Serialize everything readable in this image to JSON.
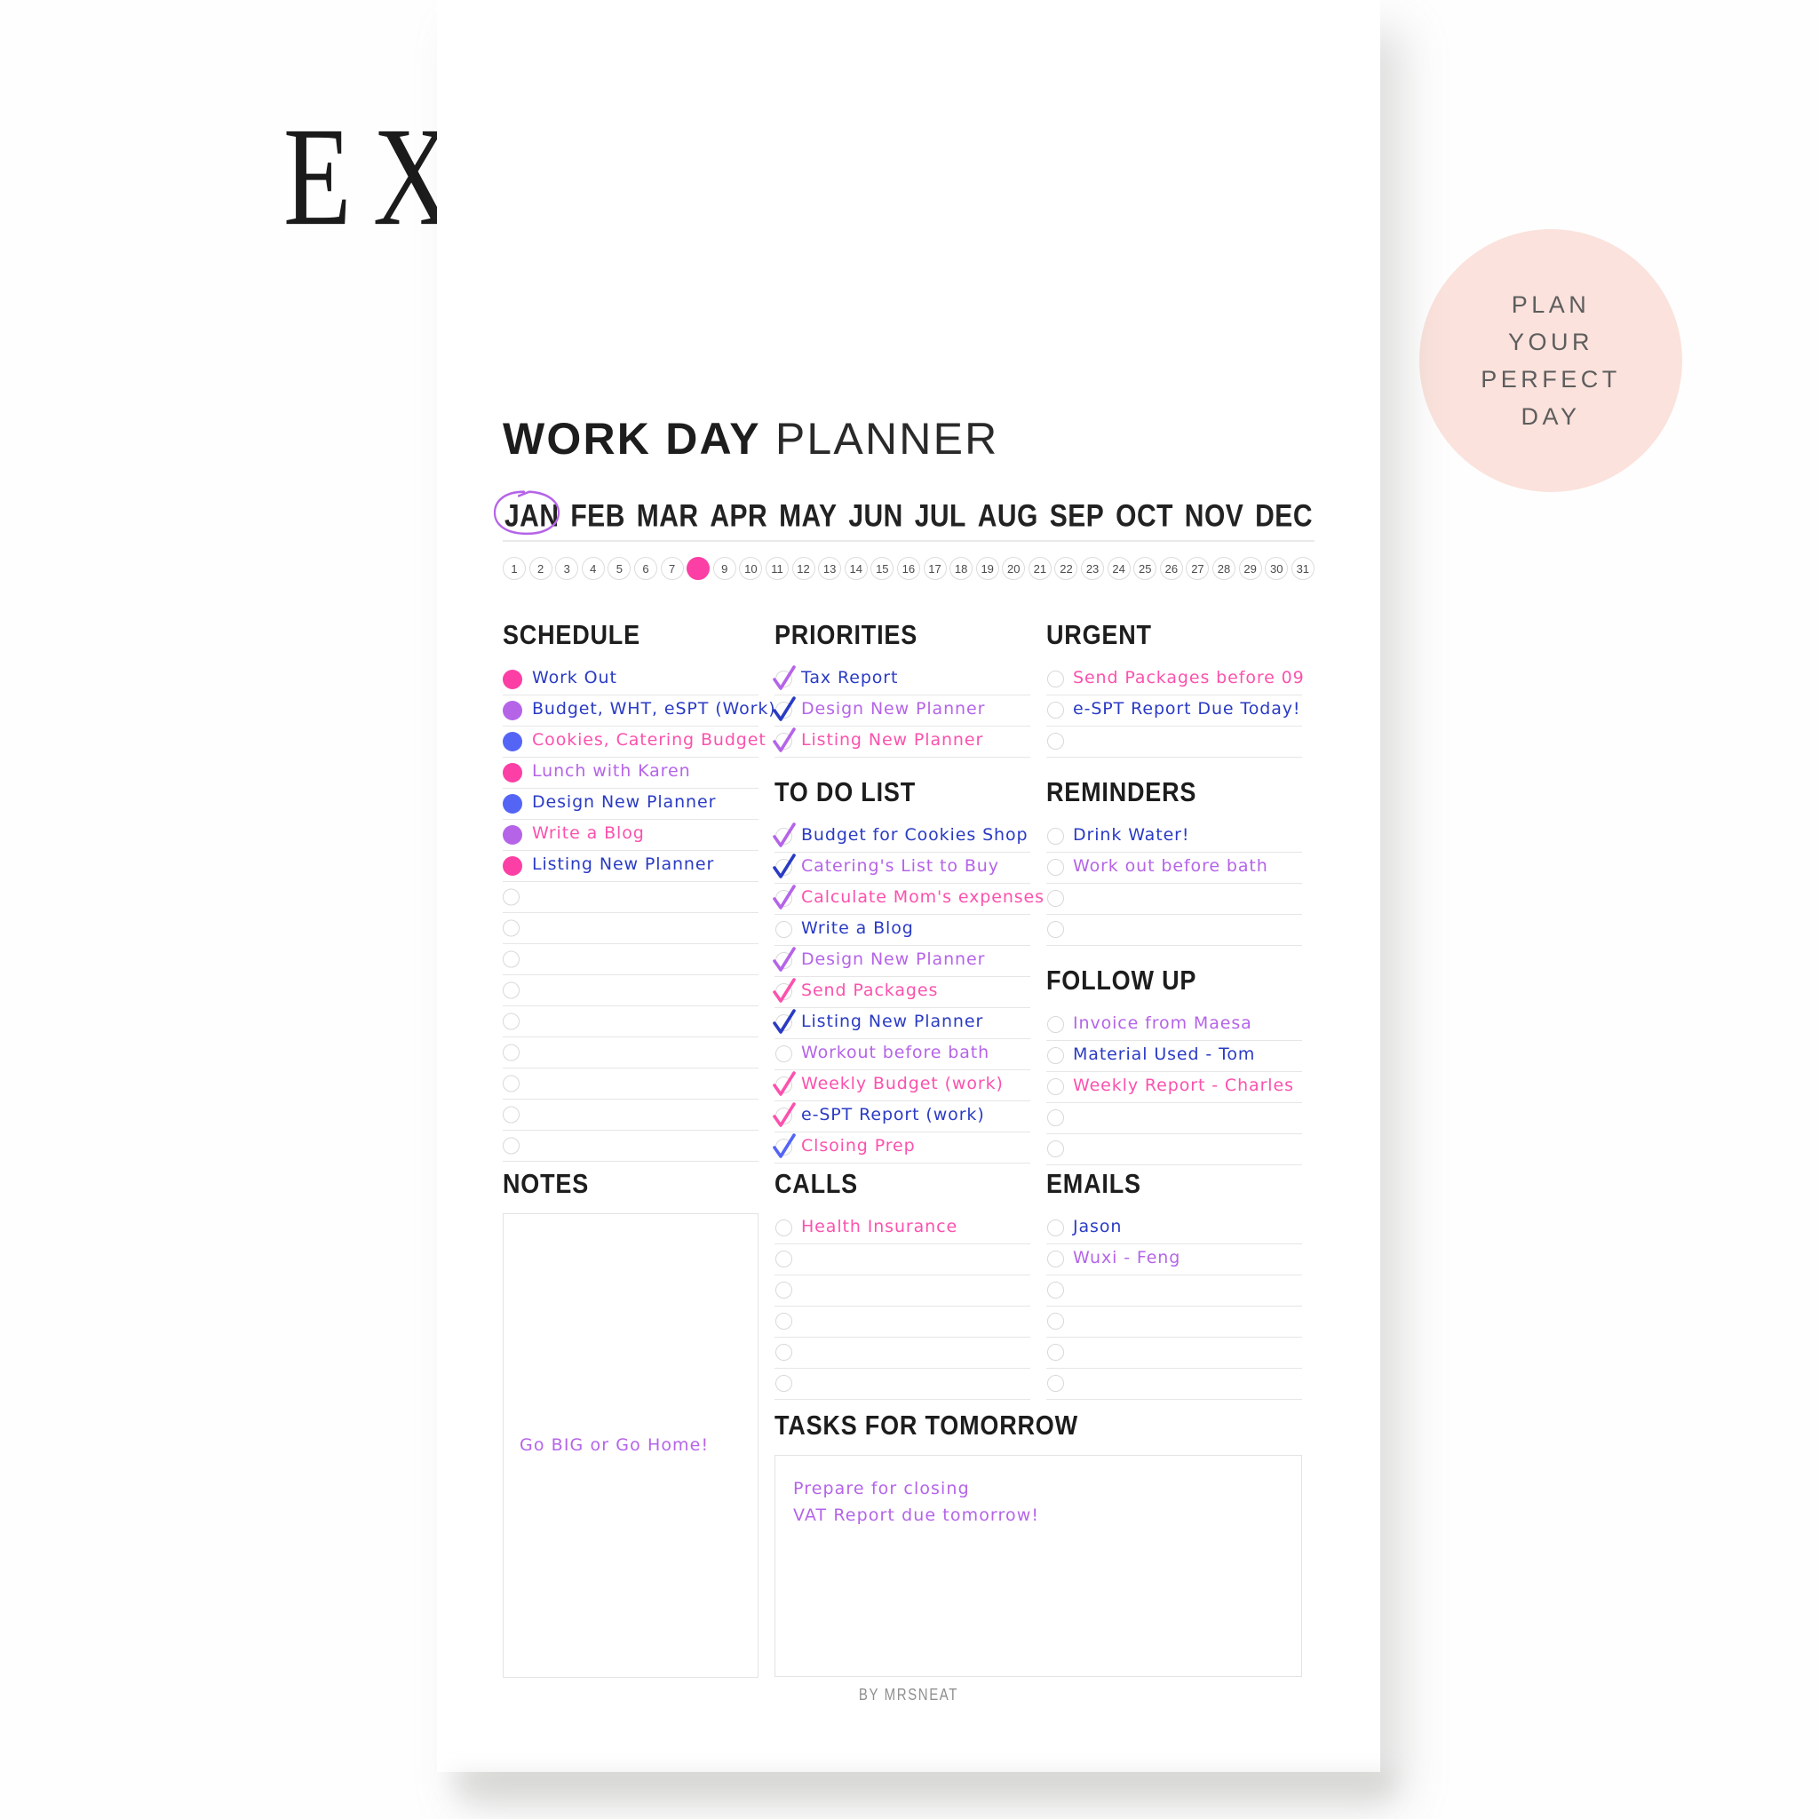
{
  "watermark": {
    "text": "EXAMPLE"
  },
  "badge": {
    "lines": [
      "PLAN",
      "YOUR",
      "PERFECT",
      "DAY"
    ],
    "bg_color": "#fbe2dc"
  },
  "page_title": {
    "bold": "WORK DAY",
    "light": "PLANNER"
  },
  "footer": {
    "text": "BY MRSNEAT"
  },
  "colors": {
    "pink": "#fb3fa5",
    "hot_pink": "#fb52ad",
    "purple": "#b564e8",
    "blue": "#2a3bc4",
    "bullet_blue": "#5465f6",
    "line": "#e6e6e6",
    "badge_pink": "#fbe2dc"
  },
  "calendar": {
    "months": [
      "JAN",
      "FEB",
      "MAR",
      "APR",
      "MAY",
      "JUN",
      "JUL",
      "AUG",
      "SEP",
      "OCT",
      "NOV",
      "DEC"
    ],
    "selected_month": "JAN",
    "days": [
      1,
      2,
      3,
      4,
      5,
      6,
      7,
      8,
      9,
      10,
      11,
      12,
      13,
      14,
      15,
      16,
      17,
      18,
      19,
      20,
      21,
      22,
      23,
      24,
      25,
      26,
      27,
      28,
      29,
      30,
      31
    ],
    "selected_day": 8
  },
  "sections": {
    "schedule": {
      "title": "SCHEDULE",
      "total_rows": 16,
      "items": [
        {
          "text": "Work Out",
          "bullet": "pink",
          "text_color": "blue"
        },
        {
          "text": "Budget, WHT, eSPT (Work)",
          "bullet": "purple",
          "text_color": "blue"
        },
        {
          "text": "Cookies, Catering Budget",
          "bullet": "bullet_blue",
          "text_color": "hot_pink"
        },
        {
          "text": "Lunch with Karen",
          "bullet": "pink",
          "text_color": "purple"
        },
        {
          "text": "Design New Planner",
          "bullet": "bullet_blue",
          "text_color": "blue"
        },
        {
          "text": "Write a Blog",
          "bullet": "purple",
          "text_color": "hot_pink"
        },
        {
          "text": "Listing New Planner",
          "bullet": "pink",
          "text_color": "blue"
        }
      ]
    },
    "priorities": {
      "title": "PRIORITIES",
      "total_rows": 3,
      "items": [
        {
          "text": "Tax Report",
          "checked": true,
          "check_color": "purple",
          "text_color": "blue"
        },
        {
          "text": "Design New Planner",
          "checked": true,
          "check_color": "blue",
          "text_color": "purple"
        },
        {
          "text": "Listing New Planner",
          "checked": true,
          "check_color": "purple",
          "text_color": "hot_pink"
        }
      ]
    },
    "todo": {
      "title": "TO DO LIST",
      "total_rows": 11,
      "items": [
        {
          "text": "Budget for Cookies Shop",
          "checked": true,
          "check_color": "purple",
          "text_color": "blue"
        },
        {
          "text": "Catering's List to Buy",
          "checked": true,
          "check_color": "blue",
          "text_color": "purple"
        },
        {
          "text": "Calculate Mom's expenses",
          "checked": true,
          "check_color": "purple",
          "text_color": "hot_pink"
        },
        {
          "text": "Write a Blog",
          "checked": false,
          "check_color": "purple",
          "text_color": "blue"
        },
        {
          "text": "Design New Planner",
          "checked": true,
          "check_color": "purple",
          "text_color": "purple"
        },
        {
          "text": "Send Packages",
          "checked": true,
          "check_color": "hot_pink",
          "text_color": "hot_pink"
        },
        {
          "text": "Listing New Planner",
          "checked": true,
          "check_color": "blue",
          "text_color": "blue"
        },
        {
          "text": "Workout before bath",
          "checked": false,
          "check_color": "purple",
          "text_color": "purple"
        },
        {
          "text": "Weekly Budget (work)",
          "checked": true,
          "check_color": "hot_pink",
          "text_color": "hot_pink"
        },
        {
          "text": "e-SPT Report (work)",
          "checked": true,
          "check_color": "hot_pink",
          "text_color": "blue"
        },
        {
          "text": "Clsoing Prep",
          "checked": true,
          "check_color": "bullet_blue",
          "text_color": "hot_pink"
        }
      ]
    },
    "urgent": {
      "title": "URGENT",
      "total_rows": 3,
      "items": [
        {
          "text": "Send Packages before 09",
          "checked": false,
          "text_color": "hot_pink"
        },
        {
          "text": "e-SPT Report Due Today!",
          "checked": false,
          "text_color": "blue"
        },
        {
          "text": "",
          "checked": false,
          "text_color": "blue"
        }
      ]
    },
    "reminders": {
      "title": "REMINDERS",
      "total_rows": 4,
      "items": [
        {
          "text": "Drink Water!",
          "checked": false,
          "text_color": "blue"
        },
        {
          "text": "Work out before bath",
          "checked": false,
          "text_color": "purple"
        },
        {
          "text": "",
          "checked": false,
          "text_color": "blue"
        },
        {
          "text": "",
          "checked": false,
          "text_color": "blue"
        }
      ]
    },
    "followup": {
      "title": "FOLLOW UP",
      "total_rows": 5,
      "items": [
        {
          "text": "Invoice from Maesa",
          "checked": false,
          "text_color": "purple"
        },
        {
          "text": "Material Used - Tom",
          "checked": false,
          "text_color": "blue"
        },
        {
          "text": "Weekly Report - Charles",
          "checked": false,
          "text_color": "hot_pink"
        },
        {
          "text": "",
          "checked": false,
          "text_color": "blue"
        },
        {
          "text": "",
          "checked": false,
          "text_color": "blue"
        }
      ]
    },
    "notes": {
      "title": "NOTES",
      "content": "Go BIG or Go Home!",
      "content_color": "purple"
    },
    "calls": {
      "title": "CALLS",
      "total_rows": 6,
      "items": [
        {
          "text": "Health Insurance",
          "checked": false,
          "text_color": "hot_pink"
        },
        {
          "text": "",
          "checked": false,
          "text_color": "blue"
        },
        {
          "text": "",
          "checked": false,
          "text_color": "blue"
        },
        {
          "text": "",
          "checked": false,
          "text_color": "blue"
        },
        {
          "text": "",
          "checked": false,
          "text_color": "blue"
        },
        {
          "text": "",
          "checked": false,
          "text_color": "blue"
        }
      ]
    },
    "emails": {
      "title": "EMAILS",
      "total_rows": 6,
      "items": [
        {
          "text": "Jason",
          "checked": false,
          "text_color": "blue"
        },
        {
          "text": "Wuxi - Feng",
          "checked": false,
          "text_color": "purple"
        },
        {
          "text": "",
          "checked": false,
          "text_color": "blue"
        },
        {
          "text": "",
          "checked": false,
          "text_color": "blue"
        },
        {
          "text": "",
          "checked": false,
          "text_color": "blue"
        },
        {
          "text": "",
          "checked": false,
          "text_color": "blue"
        }
      ]
    },
    "tasks_tomorrow": {
      "title": "TASKS FOR TOMORROW",
      "lines": [
        "Prepare for closing",
        "VAT Report due tomorrow!"
      ],
      "content_color": "purple"
    }
  }
}
